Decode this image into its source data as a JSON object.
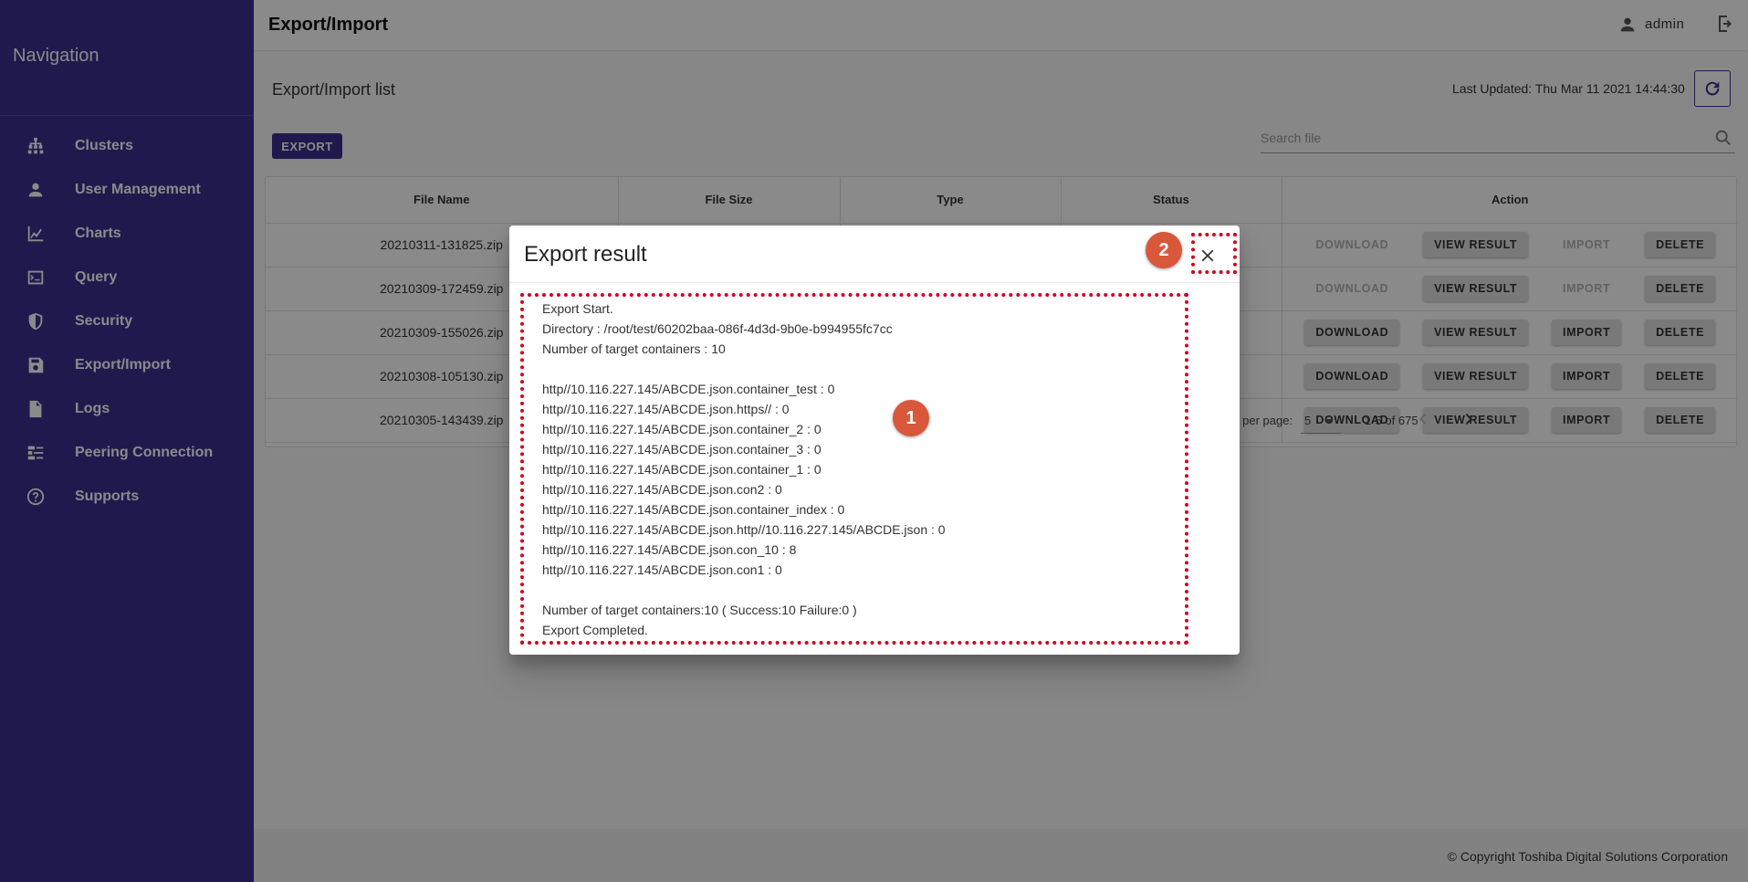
{
  "sidebar": {
    "title": "Navigation",
    "items": [
      {
        "label": "Clusters",
        "icon": "cluster-icon"
      },
      {
        "label": "User Management",
        "icon": "person-icon"
      },
      {
        "label": "Charts",
        "icon": "chart-line-icon"
      },
      {
        "label": "Query",
        "icon": "terminal-icon"
      },
      {
        "label": "Security",
        "icon": "shield-icon"
      },
      {
        "label": "Export/Import",
        "icon": "save-icon"
      },
      {
        "label": "Logs",
        "icon": "document-icon"
      },
      {
        "label": "Peering Connection",
        "icon": "peering-icon"
      },
      {
        "label": "Supports",
        "icon": "help-icon"
      }
    ]
  },
  "header": {
    "title": "Export/Import",
    "user": "admin"
  },
  "content": {
    "list_title": "Export/Import list",
    "last_updated": "Last Updated: Thu Mar 11 2021 14:44:30",
    "export_label": "EXPORT",
    "search_placeholder": "Search file"
  },
  "table": {
    "columns": [
      "File Name",
      "File Size",
      "Type",
      "Status",
      "Action"
    ],
    "rows": [
      {
        "file_name": "20210311-131825.zip",
        "download_enabled": false,
        "import_enabled": false
      },
      {
        "file_name": "20210309-172459.zip",
        "download_enabled": false,
        "import_enabled": false
      },
      {
        "file_name": "20210309-155026.zip",
        "download_enabled": true,
        "import_enabled": true
      },
      {
        "file_name": "20210308-105130.zip",
        "download_enabled": true,
        "import_enabled": true
      },
      {
        "file_name": "20210305-143439.zip",
        "download_enabled": true,
        "import_enabled": true
      }
    ],
    "action_labels": {
      "download": "DOWNLOAD",
      "view_result": "VIEW RESULT",
      "import": "IMPORT",
      "delete": "DELETE"
    }
  },
  "pagination": {
    "rows_per_page_label": "Rows per page:",
    "rows_per_page": "5",
    "range": "1-5 of 675"
  },
  "footer": {
    "copyright": "© Copyright Toshiba Digital Solutions Corporation"
  },
  "dialog": {
    "title": "Export result",
    "lines": [
      "Export Start.",
      "Directory : /root/test/60202baa-086f-4d3d-9b0e-b994955fc7cc",
      "Number of target containers : 10",
      "",
      "http//10.116.227.145/ABCDE.json.container_test : 0",
      "http//10.116.227.145/ABCDE.json.https// : 0",
      "http//10.116.227.145/ABCDE.json.container_2 : 0",
      "http//10.116.227.145/ABCDE.json.container_3 : 0",
      "http//10.116.227.145/ABCDE.json.container_1 : 0",
      "http//10.116.227.145/ABCDE.json.con2 : 0",
      "http//10.116.227.145/ABCDE.json.container_index : 0",
      "http//10.116.227.145/ABCDE.json.http//10.116.227.145/ABCDE.json : 0",
      "http//10.116.227.145/ABCDE.json.con_10 : 8",
      "http//10.116.227.145/ABCDE.json.con1 : 0",
      "",
      "Number of target containers:10 ( Success:10 Failure:0 )",
      "Export Completed."
    ]
  },
  "annotations": {
    "badge_1": "1",
    "badge_2": "2",
    "highlight_color": "#d0021b",
    "badge_color": "#d9573a"
  },
  "colors": {
    "sidebar": "#3c2f8f",
    "accent": "#3c2f8f"
  }
}
